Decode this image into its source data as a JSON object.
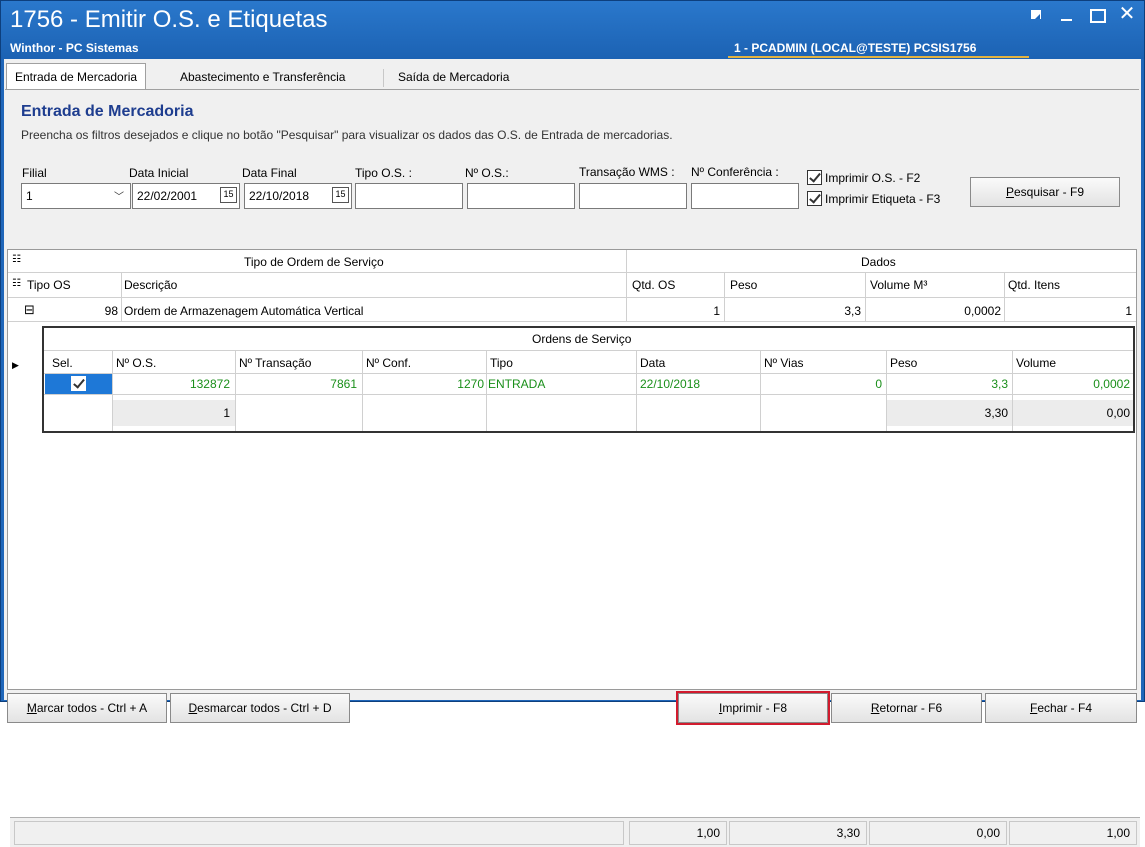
{
  "window": {
    "title": "1756 - Emitir O.S. e Etiquetas",
    "subtitle": "Winthor - PC Sistemas",
    "user_info": "1 - PCADMIN (LOCAL@TESTE)   PCSIS1756",
    "controls": [
      "restore-icon",
      "minimize-icon",
      "maximize-icon",
      "close-icon"
    ]
  },
  "tabs": [
    {
      "label": "Entrada de Mercadoria",
      "active": true
    },
    {
      "label": "Abastecimento e Transferência",
      "active": false
    },
    {
      "label": "Saída de Mercadoria",
      "active": false
    }
  ],
  "page": {
    "heading": "Entrada de Mercadoria",
    "hint": "Preencha os filtros desejados e clique no botão \"Pesquisar\" para visualizar os dados das O.S. de Entrada de mercadorias."
  },
  "filters": {
    "filial": {
      "label": "Filial",
      "value": "1"
    },
    "data_inicial": {
      "label": "Data Inicial",
      "value": "22/02/2001",
      "cal_icon": "15"
    },
    "data_final": {
      "label": "Data Final",
      "value": "22/10/2018",
      "cal_icon": "15"
    },
    "tipo_os": {
      "label": "Tipo O.S. :",
      "value": ""
    },
    "num_os": {
      "label": "Nº O.S.:",
      "value": ""
    },
    "transacao_wms": {
      "label": "Transação WMS :",
      "value": ""
    },
    "num_conferencia": {
      "label": "Nº Conferência :",
      "value": ""
    },
    "imprimir_os": {
      "label": "Imprimir O.S. - F2",
      "checked": true
    },
    "imprimir_etiqueta": {
      "label": "Imprimir Etiqueta - F3",
      "checked": true
    },
    "pesquisar_button": {
      "label_hotkey": "P",
      "label_rest": "esquisar - F9"
    }
  },
  "grid": {
    "band_left": "Tipo de Ordem de Serviço",
    "band_right": "Dados",
    "columns": {
      "tipo_os": "Tipo OS",
      "descricao": "Descrição",
      "qtd_os": "Qtd. OS",
      "peso": "Peso",
      "volume": "Volume M³",
      "qtd_itens": "Qtd. Itens"
    },
    "master_row": {
      "expand": "⊟",
      "tipo_os": "98",
      "descricao": "Ordem de Armazenagem Automática Vertical",
      "qtd_os": "1",
      "peso": "3,3",
      "volume": "0,0002",
      "qtd_itens": "1"
    },
    "detail": {
      "title": "Ordens de Serviço",
      "columns": {
        "sel": "Sel.",
        "num_os": "Nº O.S.",
        "num_transacao": "Nº Transação",
        "num_conf": "Nº Conf.",
        "tipo": "Tipo",
        "data": "Data",
        "num_vias": "Nº Vias",
        "peso": "Peso",
        "volume": "Volume"
      },
      "rows": [
        {
          "sel": true,
          "num_os": "132872",
          "num_transacao": "7861",
          "num_conf": "1270",
          "tipo": "ENTRADA",
          "data": "22/10/2018",
          "num_vias": "0",
          "peso": "3,3",
          "volume": "0,0002"
        }
      ],
      "footer": {
        "count": "1",
        "peso": "3,30",
        "volume": "0,00"
      }
    },
    "totals": {
      "qtd_os": "1,00",
      "peso": "3,30",
      "volume": "0,00",
      "qtd_itens": "1,00"
    },
    "colors": {
      "selected": "#1e78d7",
      "green_text": "#1a8f1a"
    }
  },
  "buttons": {
    "marcar_todos": {
      "hotkey": "M",
      "rest": "arcar todos - Ctrl + A"
    },
    "desmarcar_todos": {
      "hotkey": "D",
      "rest": "esmarcar todos - Ctrl + D"
    },
    "imprimir": {
      "hotkey": "I",
      "rest": "mprimir - F8"
    },
    "retornar": {
      "hotkey": "R",
      "rest": "etornar - F6"
    },
    "fechar": {
      "hotkey": "F",
      "rest": "echar - F4"
    }
  },
  "colors": {
    "title_bar": "#1f66b9",
    "heading": "#1e3d8f",
    "highlight_border": "#d21b2e"
  }
}
